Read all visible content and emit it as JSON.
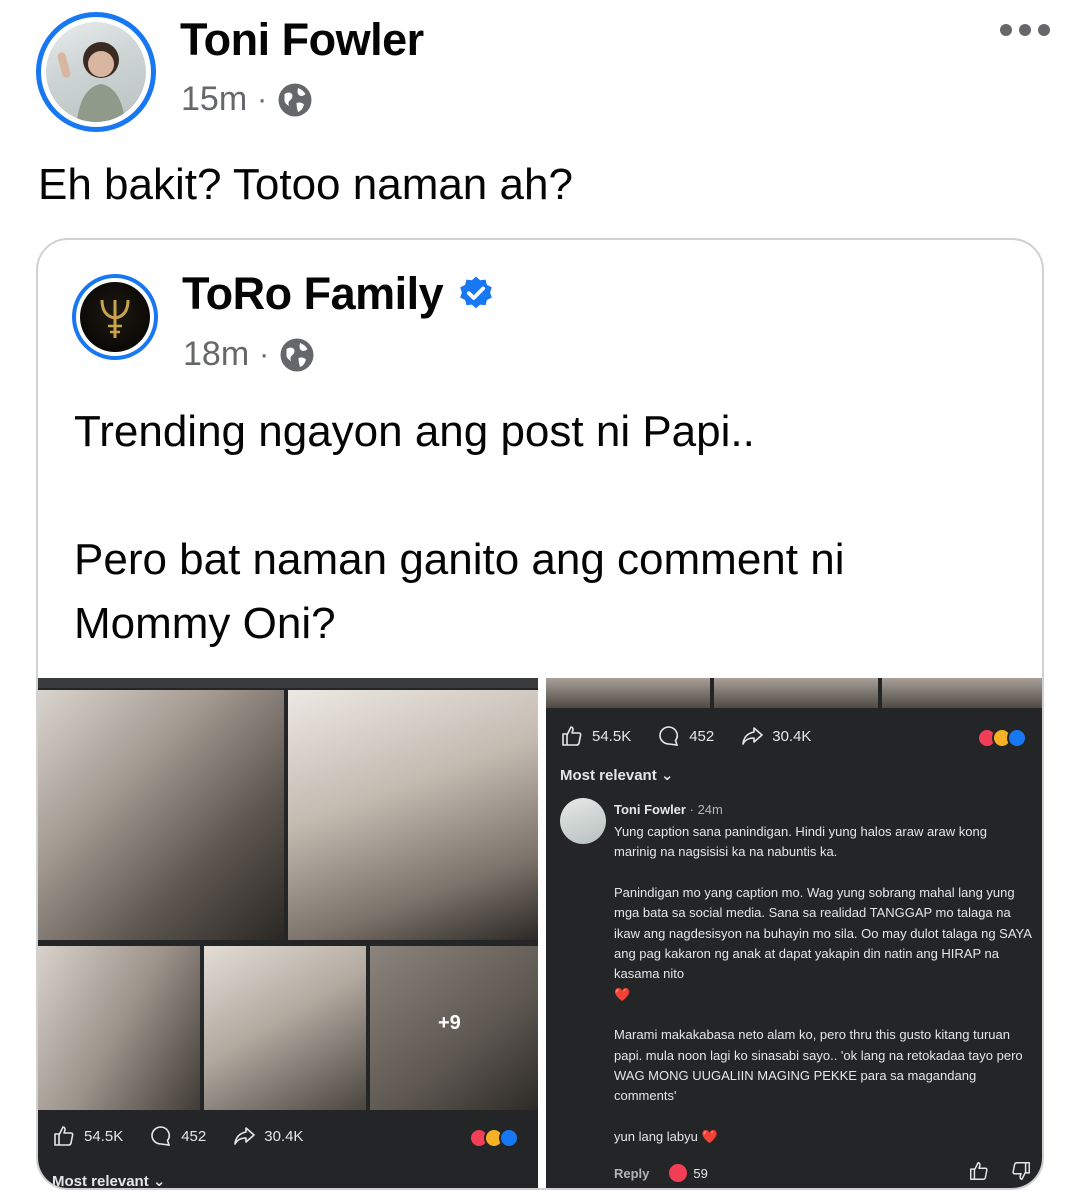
{
  "post": {
    "author": "Toni Fowler",
    "time": "15m",
    "separator": "·",
    "text": "Eh bakit? Totoo naman ah?"
  },
  "shared": {
    "author": "ToRo Family",
    "time": "18m",
    "separator": "·",
    "lines": [
      "Trending ngayon ang post ni Papi..",
      "Pero bat naman ganito ang comment ni",
      "Mommy Oni?"
    ]
  },
  "screenshot_left": {
    "plus_count": "+9",
    "likes": "54.5K",
    "comments": "452",
    "shares": "30.4K",
    "sort_label": "Most relevant"
  },
  "screenshot_right": {
    "likes": "54.5K",
    "comments": "452",
    "shares": "30.4K",
    "sort_label": "Most relevant",
    "comment": {
      "author": "Toni Fowler",
      "time": "24m",
      "paragraphs": [
        "Yung caption sana panindigan. Hindi yung halos araw araw kong marinig na nagsisisi ka na nabuntis ka.",
        "Panindigan mo yang caption mo. Wag yung sobrang mahal lang yung mga bata sa social media. Sana sa realidad TANGGAP mo talaga na ikaw ang nagdesisyon na buhayin mo sila. Oo may dulot talaga ng SAYA ang pag kakaron ng anak at dapat yakapin din natin ang HIRAP na kasama nito",
        "Marami makakabasa neto alam ko, pero thru this gusto kitang turuan papi. mula noon lagi ko sinasabi sayo.. 'ok lang na retokadaa tayo pero WAG MONG UUGALIIN MAGING PEKKE para sa magandang comments'",
        "yun lang labyu"
      ],
      "heart": "❤️",
      "reply_label": "Reply",
      "reaction_count": "59"
    }
  },
  "colors": {
    "accent": "#1877f2",
    "secondary_text": "#65676b",
    "dark_bg": "#242526"
  },
  "icons": [
    "globe-icon",
    "more-icon",
    "verified-badge-icon",
    "like-icon",
    "comment-icon",
    "share-icon",
    "chevron-down-icon",
    "thumbs-up-icon",
    "thumbs-down-icon"
  ]
}
